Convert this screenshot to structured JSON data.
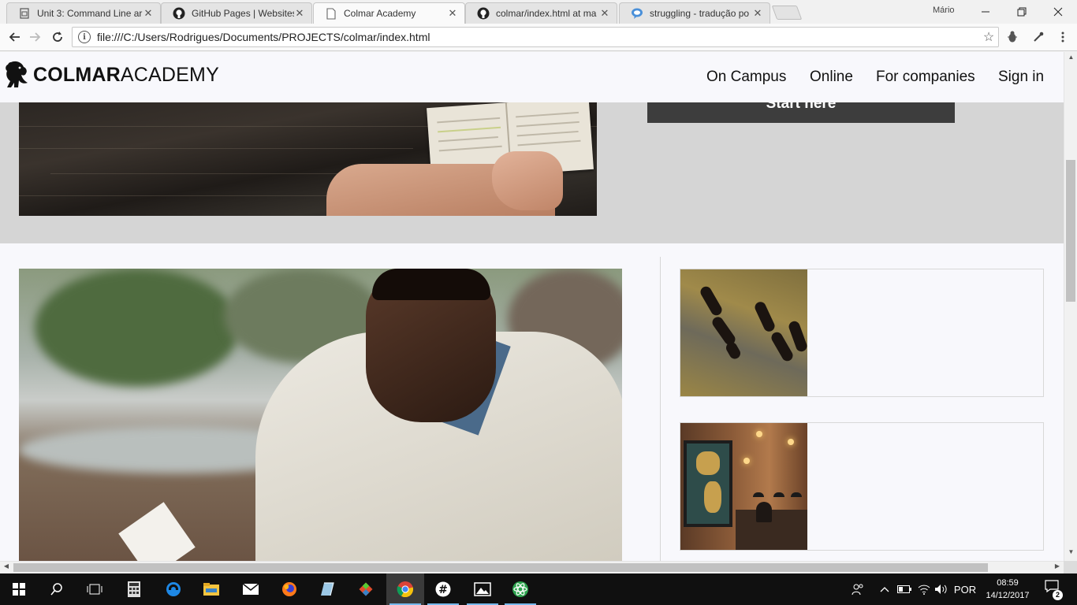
{
  "browser": {
    "tabs": [
      {
        "title": "Unit 3: Command Line ar",
        "icon": "doc-icon"
      },
      {
        "title": "GitHub Pages | Websites",
        "icon": "github-icon"
      },
      {
        "title": "Colmar Academy",
        "icon": "page-icon",
        "active": true
      },
      {
        "title": "colmar/index.html at ma",
        "icon": "github-icon"
      },
      {
        "title": "struggling - tradução po",
        "icon": "chat-bubble-icon"
      }
    ],
    "close_glyph": "✕",
    "profile_name": "Mário",
    "address": "file:///C:/Users/Rodrigues/Documents/PROJECTS/colmar/index.html",
    "info_glyph": "i",
    "star_glyph": "☆"
  },
  "site": {
    "brand_bold": "COLMAR",
    "brand_rest": "ACADEMY",
    "nav": [
      "On Campus",
      "Online",
      "For companies",
      "Sign in"
    ],
    "cta_label": "Start here"
  },
  "taskbar": {
    "language": "POR",
    "time": "08:59",
    "date": "14/12/2017",
    "notifications": "2"
  }
}
